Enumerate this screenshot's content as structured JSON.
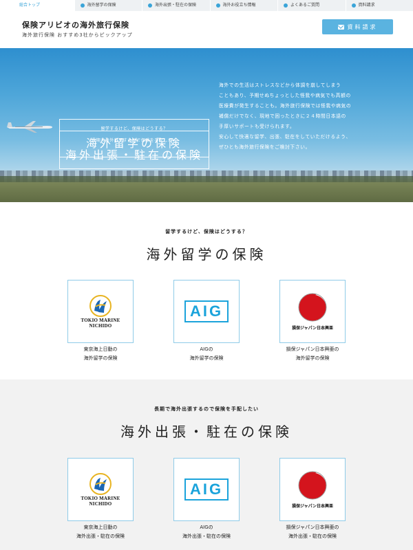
{
  "topnav": {
    "items": [
      {
        "label": "総合トップ"
      },
      {
        "label": "海外留学の保険"
      },
      {
        "label": "海外出張・駐在の保険"
      },
      {
        "label": "海外お役立ち情報"
      },
      {
        "label": "よくあるご質問"
      },
      {
        "label": "資料請求"
      }
    ]
  },
  "header": {
    "title": "保険アリビオの海外旅行保険",
    "subtitle": "海外旅行保険 おすすめ3社からピックアップ",
    "request_button": "資料請求",
    "request_icon": "mail-icon"
  },
  "hero": {
    "study_box": {
      "sub": "留学するけど、保険はどうする？",
      "main": "海外留学の保険"
    },
    "business_box": {
      "sub": "長期で海外出張するので保険を手配したい",
      "main": "海外出張・駐在の保険"
    },
    "text_lines": [
      "海外での生活はストレスなどから体調を崩してしまう",
      "こともあり、予期せぬちょっとした怪我や病気でも高額の",
      "医療費が発生することも。海外旅行保険では怪我や病気の",
      "補償だけでなく、現地で困ったときに２４時間日本語の",
      "手厚いサポートも受けられます。",
      "安心して快適な留学、出張、駐在をしていただけるよう、",
      "ぜひとも海外旅行保険をご検討下さい。"
    ]
  },
  "study_section": {
    "sub": "留学するけど、保険はどうする？",
    "title": "海外留学の保険",
    "cards": [
      {
        "logo_text_1": "TOKIO MARINE",
        "logo_text_2": "NICHIDO",
        "label_1": "東京海上日動の",
        "label_2": "海外留学の保険"
      },
      {
        "logo_text": "AIG",
        "label_1": "AIGの",
        "label_2": "海外留学の保険"
      },
      {
        "logo_text": "損保ジャパン日本興亜",
        "label_1": "損保ジャパン日本興亜の",
        "label_2": "海外留学の保険"
      }
    ]
  },
  "business_section": {
    "sub": "長期で海外出張するので保険を手配したい",
    "title": "海外出張・駐在の保険",
    "cards": [
      {
        "logo_text_1": "TOKIO MARINE",
        "logo_text_2": "NICHIDO",
        "label_1": "東京海上日動の",
        "label_2": "海外出張・駐在の保険"
      },
      {
        "logo_text": "AIG",
        "label_1": "AIGの",
        "label_2": "海外出張・駐在の保険"
      },
      {
        "logo_text": "損保ジャパン日本興亜",
        "label_1": "損保ジャパン日本興亜の",
        "label_2": "海外出張・駐在の保険"
      }
    ]
  },
  "colors": {
    "accent": "#3aa4d8",
    "button": "#5ab3e0",
    "aig_blue": "#1aa3db",
    "sompo_red": "#d4141d",
    "tokio_blue": "#1b66b3",
    "tokio_gold": "#e8b422"
  }
}
